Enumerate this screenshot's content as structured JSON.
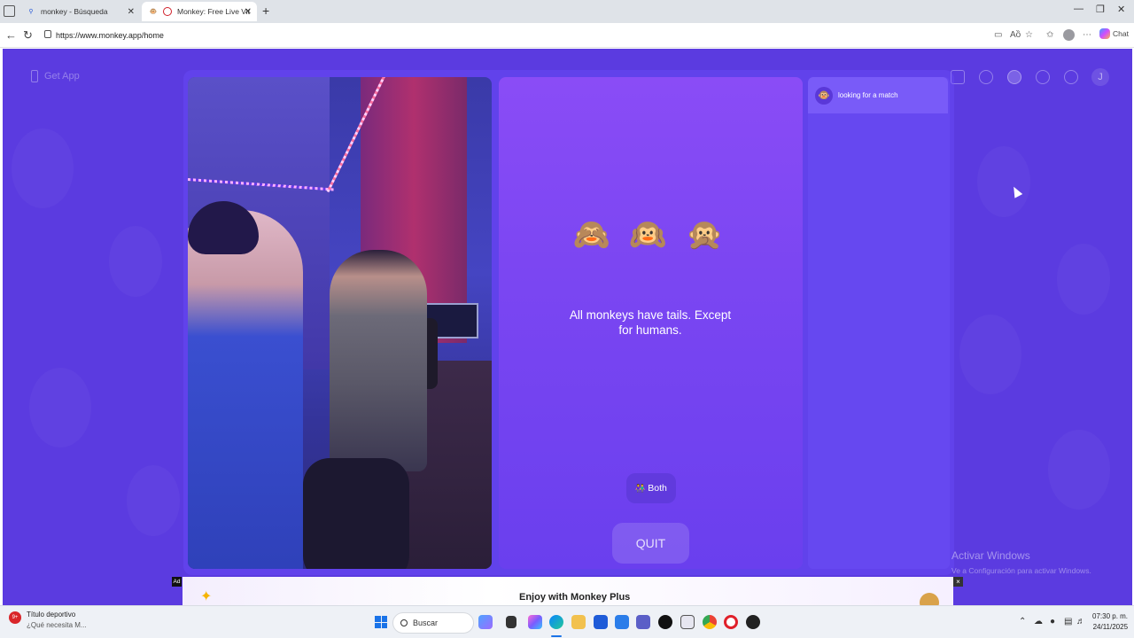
{
  "browser": {
    "tabs": [
      {
        "label": "monkey - Búsqueda",
        "active": false
      },
      {
        "label": "Monkey: Free Live Video Ch",
        "active": true
      }
    ],
    "new_tab": "+",
    "url": "https://www.monkey.app/home",
    "copilot_label": "Chat"
  },
  "page": {
    "get_app": "Get App",
    "user_initial": "J",
    "match": {
      "emojis": "🙈 🙉 🙊",
      "quote": "All monkeys have tails. Except for humans.",
      "gender_filter": "Both",
      "gender_icon": "👫",
      "quit": "QUIT"
    },
    "chat": {
      "avatar": "🐵",
      "status": "looking for a match"
    },
    "ad": {
      "tag": "Ad",
      "title": "Enjoy with Monkey Plus",
      "close": "×"
    },
    "watermark": {
      "title": "Activar Windows",
      "subtitle": "Ve a Configuración para activar Windows."
    }
  },
  "taskbar": {
    "weather_badge": "9+",
    "weather_title": "Título deportivo",
    "weather_subtitle": "¿Qué necesita M...",
    "search": "Buscar",
    "time": "07:30 p. m.",
    "date": "24/11/2025"
  },
  "colors": {
    "page_bg": "#5b3be0",
    "match_bg": "#8a4cf6",
    "accent": "#1a73e8"
  }
}
